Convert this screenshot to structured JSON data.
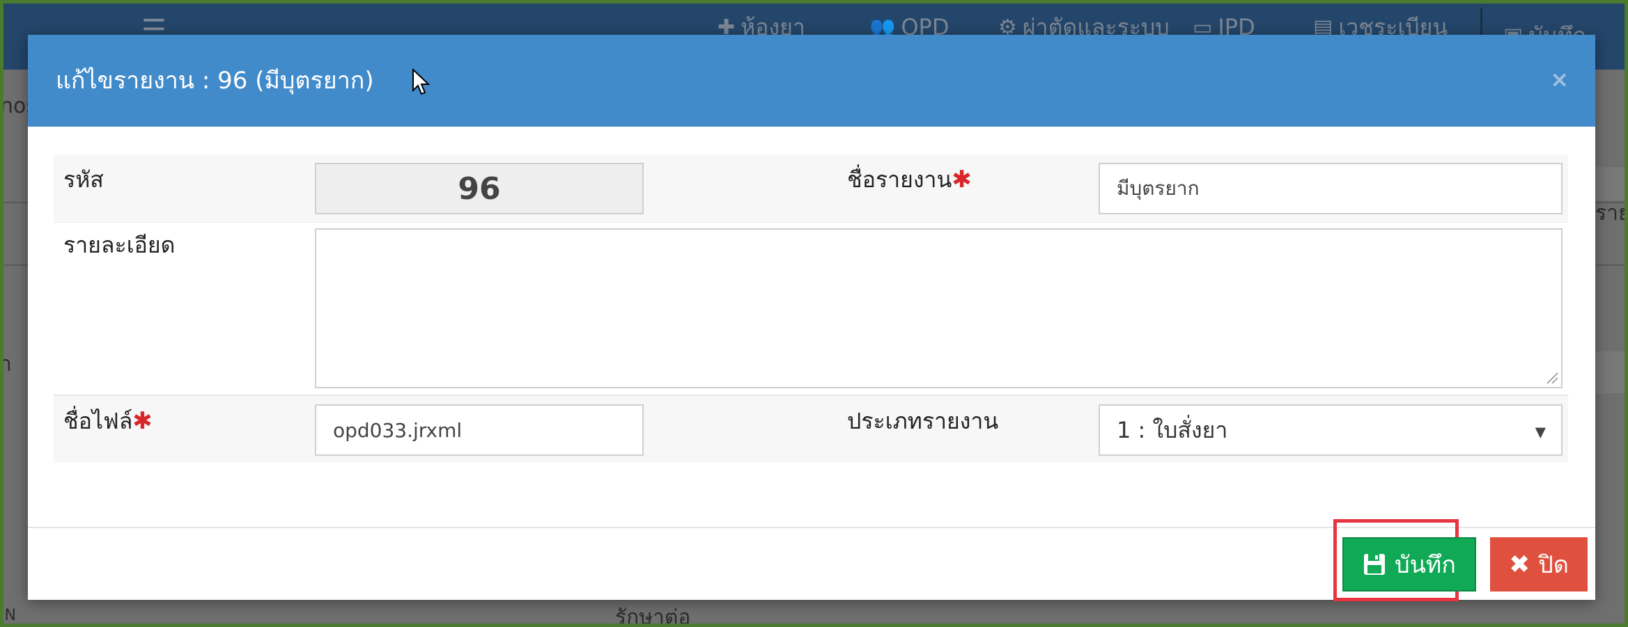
{
  "background": {
    "nav": {
      "pharmacy": "ห้องยา",
      "opd": "OPD",
      "surgery": "ผ่าตัดและระบบ",
      "ipd": "IPD",
      "registration": "เวชระเบียน",
      "save": "บันทึก"
    },
    "left_text_1": "nos",
    "left_text_2": "า",
    "left_text_3": "IN",
    "right_text": "ราย",
    "bottom_text": "รักษาต่อ"
  },
  "modal": {
    "title": "แก้ไขรายงาน : 96 (มีบุตรยาก)",
    "close_glyph": "×",
    "fields": {
      "code_label": "รหัส",
      "code_value": "96",
      "report_name_label": "ชื่อรายงาน",
      "report_name_value": "มีบุตรยาก",
      "detail_label": "รายละเอียด",
      "detail_value": "",
      "file_name_label": "ชื่อไฟล์",
      "file_name_value": "opd033.jrxml",
      "report_type_label": "ประเภทรายงาน",
      "report_type_value": "1 : ใบสั่งยา"
    },
    "required_mark": "✱",
    "buttons": {
      "save_label": "บันทึก",
      "close_label": "ปิด"
    }
  },
  "colors": {
    "header_blue": "#428bca",
    "save_green": "#10a955",
    "close_red": "#e0503f",
    "highlight_red": "#e8353f",
    "required_red": "#d9262b"
  },
  "icons": [
    "save-icon",
    "close-x-icon",
    "cursor-icon",
    "users-icon",
    "gears-icon",
    "bed-icon",
    "card-icon",
    "medkit-icon",
    "hamburger-icon"
  ]
}
